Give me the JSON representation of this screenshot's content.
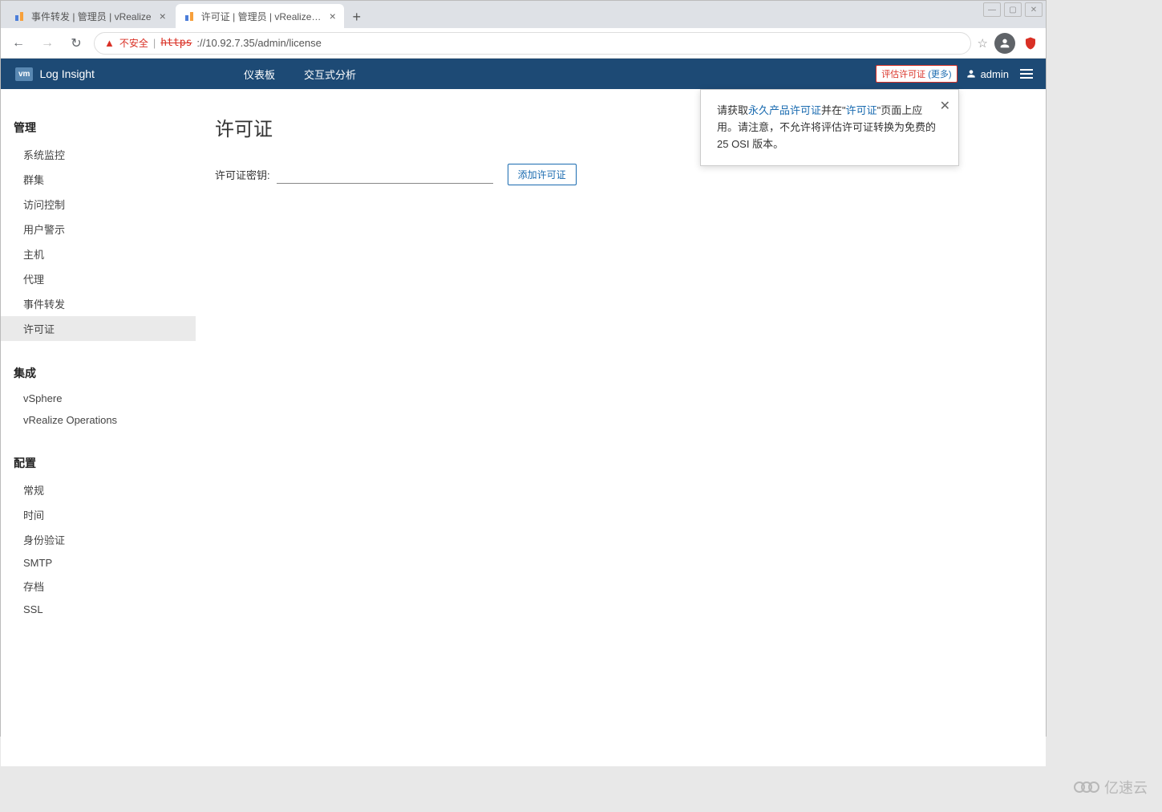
{
  "window_controls": {
    "min": "—",
    "max": "▢",
    "close": "✕"
  },
  "tabs": [
    {
      "title": "事件转发 | 管理员 | vRealize",
      "active": false
    },
    {
      "title": "许可证 | 管理员 | vRealize Lo",
      "active": true
    }
  ],
  "new_tab": "+",
  "nav": {
    "back": "←",
    "forward": "→",
    "reload": "↻"
  },
  "url": {
    "insecure_label": "不安全",
    "https": "https",
    "sep": "://",
    "host": "10.92.7.35",
    "path": "/admin/license"
  },
  "header": {
    "logo_badge": "vm",
    "product": "Log Insight",
    "nav": [
      "仪表板",
      "交互式分析"
    ],
    "license_badge_text": "评估许可证",
    "license_badge_more": "(更多)",
    "user": "admin"
  },
  "sidebar": {
    "sections": [
      {
        "title": "管理",
        "items": [
          "系统监控",
          "群集",
          "访问控制",
          "用户警示",
          "主机",
          "代理",
          "事件转发",
          "许可证"
        ],
        "active_index": 7
      },
      {
        "title": "集成",
        "items": [
          "vSphere",
          "vRealize Operations"
        ],
        "active_index": -1
      },
      {
        "title": "配置",
        "items": [
          "常规",
          "时间",
          "身份验证",
          "SMTP",
          "存档",
          "SSL"
        ],
        "active_index": -1
      }
    ]
  },
  "content": {
    "title": "许可证",
    "key_label": "许可证密钥:",
    "key_value": "",
    "add_button": "添加许可证"
  },
  "tooltip": {
    "pre1": "请获取",
    "link1": "永久产品许可证",
    "mid1": "并在\"",
    "link2": "许可证",
    "post1": "\"页面上应用。请注意，不允许将评估许可证转换为免费的 25 OSI 版本。",
    "close": "✕"
  },
  "watermark": "亿速云"
}
